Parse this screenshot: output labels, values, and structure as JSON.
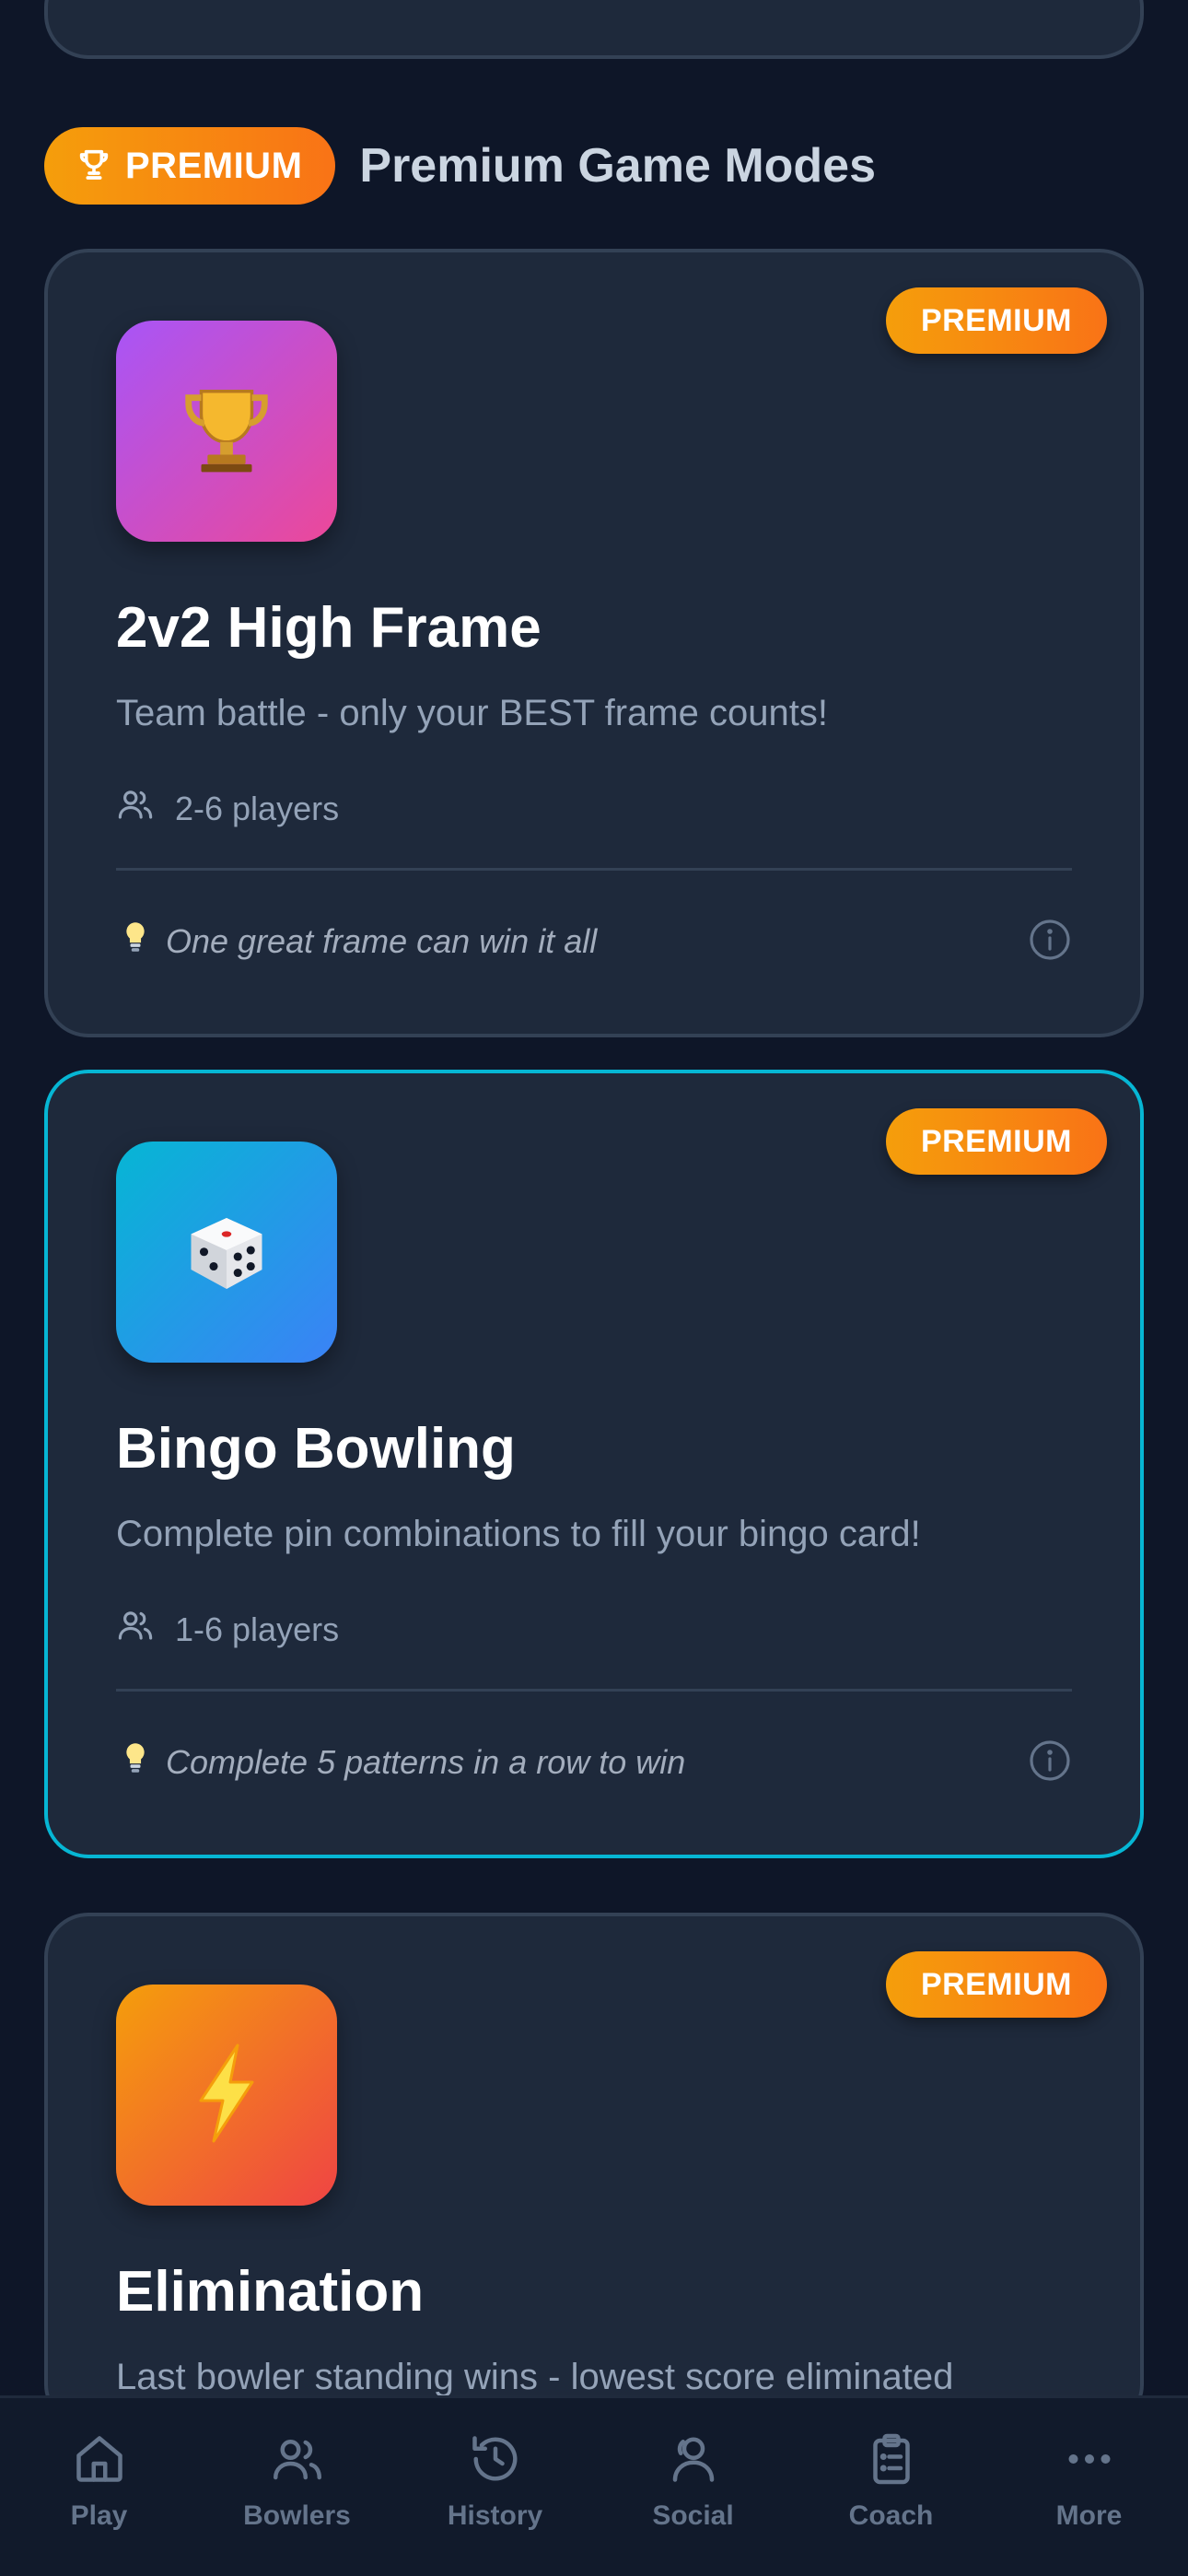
{
  "section": {
    "pill_label": "PREMIUM",
    "title": "Premium Game Modes"
  },
  "modes": [
    {
      "badge": "PREMIUM",
      "icon": "trophy-icon",
      "title": "2v2 High Frame",
      "description": "Team battle - only your BEST frame counts!",
      "players": "2-6 players",
      "tip": "One great frame can win it all"
    },
    {
      "badge": "PREMIUM",
      "icon": "dice-icon",
      "title": "Bingo Bowling",
      "description": "Complete pin combinations to fill your bingo card!",
      "players": "1-6 players",
      "tip": "Complete 5 patterns in a row to win"
    },
    {
      "badge": "PREMIUM",
      "icon": "lightning-icon",
      "title": "Elimination",
      "description": "Last bowler standing wins - lowest score eliminated"
    }
  ],
  "nav": {
    "items": [
      {
        "label": "Play",
        "icon": "home-icon"
      },
      {
        "label": "Bowlers",
        "icon": "users-icon"
      },
      {
        "label": "History",
        "icon": "history-icon"
      },
      {
        "label": "Social",
        "icon": "social-icon"
      },
      {
        "label": "Coach",
        "icon": "clipboard-icon"
      },
      {
        "label": "More",
        "icon": "more-icon"
      }
    ]
  },
  "colors": {
    "background": "#0e1628",
    "card": "#1e293b",
    "premium_orange": "#f97316",
    "selected_border": "#06b6d4"
  }
}
